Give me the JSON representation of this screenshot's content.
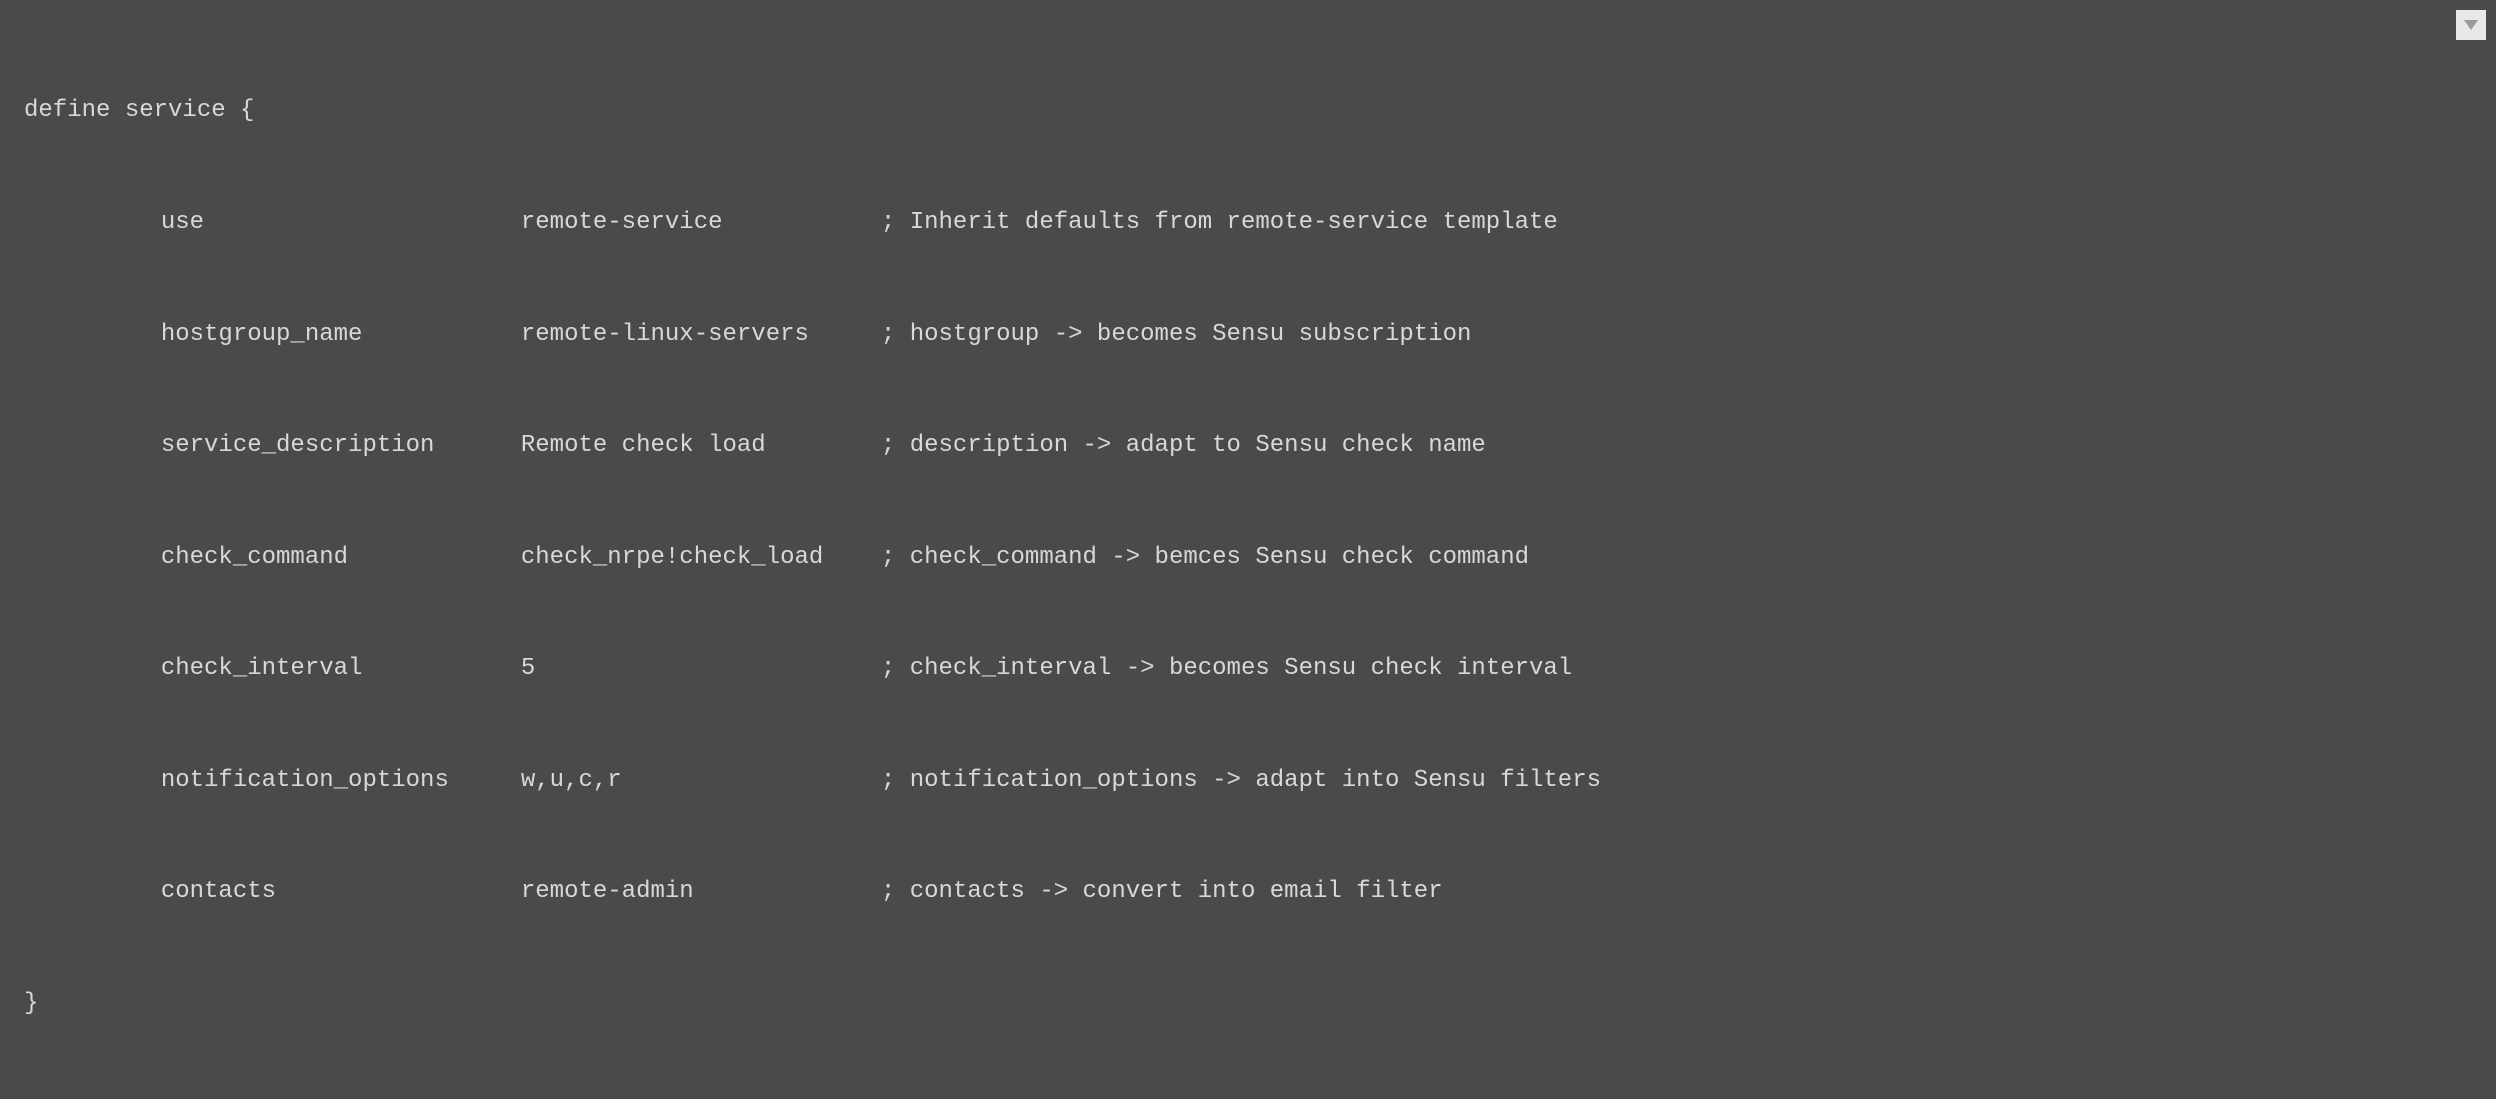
{
  "code": {
    "open": "define service {",
    "close": "}",
    "rows": [
      {
        "key": "use",
        "value": "remote-service",
        "comment": "Inherit defaults from remote-service template"
      },
      {
        "key": "hostgroup_name",
        "value": "remote-linux-servers",
        "comment": "hostgroup -> becomes Sensu subscription"
      },
      {
        "key": "service_description",
        "value": "Remote check load",
        "comment": "description -> adapt to Sensu check name"
      },
      {
        "key": "check_command",
        "value": "check_nrpe!check_load",
        "comment": "check_command -> bemces Sensu check command"
      },
      {
        "key": "check_interval",
        "value": "5",
        "comment": "check_interval -> becomes Sensu check interval"
      },
      {
        "key": "notification_options",
        "value": "w,u,c,r",
        "comment": "notification_options -> adapt into Sensu filters"
      },
      {
        "key": "contacts",
        "value": "remote-admin",
        "comment": "contacts -> convert into email filter"
      }
    ],
    "semicolon": ";"
  }
}
